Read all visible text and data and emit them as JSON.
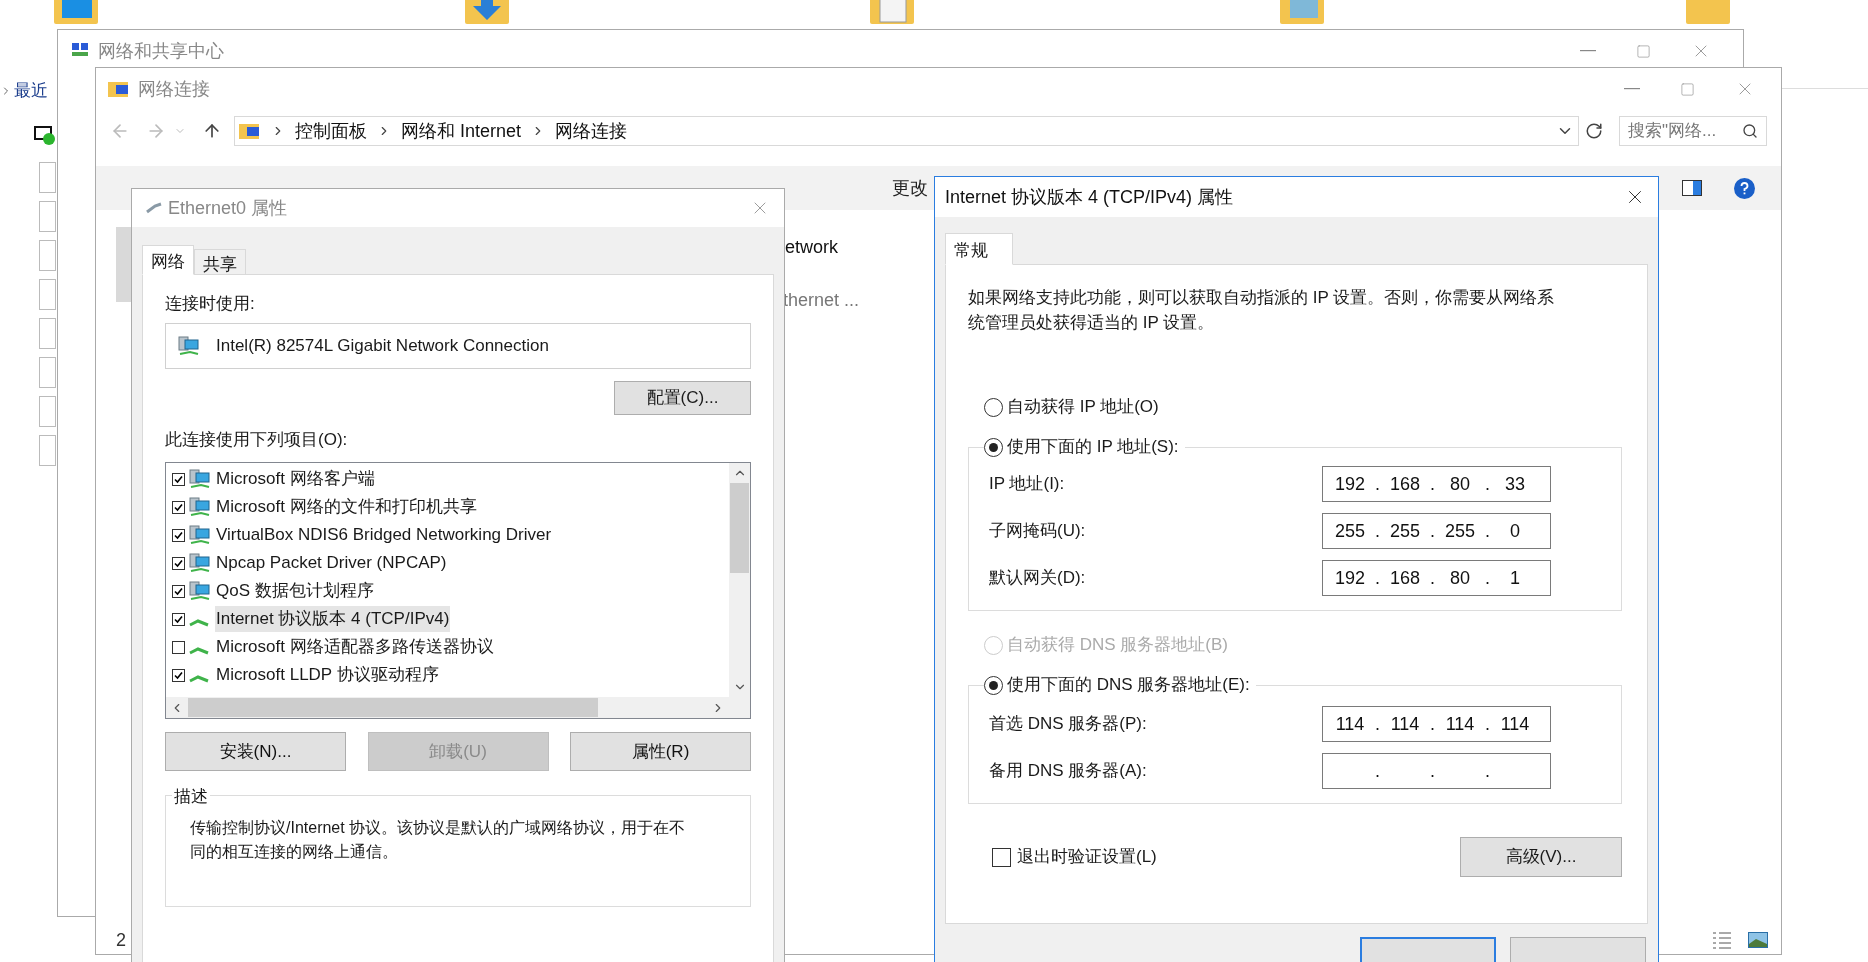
{
  "nav": {
    "label": "最近"
  },
  "sharing_center": {
    "title": "网络和共享中心"
  },
  "connections": {
    "title": "网络连接",
    "breadcrumb": [
      "控制面板",
      "网络和 Internet",
      "网络连接"
    ],
    "search": {
      "placeholder": "搜索\"网络..."
    },
    "toolbar": [
      "更改"
    ],
    "items": [
      {
        "name": "etwork"
      },
      {
        "name": "thernet ..."
      }
    ],
    "status_count": "2"
  },
  "ethernet_dialog": {
    "title": "Ethernet0 属性",
    "tabs": [
      {
        "label": "网络",
        "selected": true
      },
      {
        "label": "共享",
        "selected": false
      }
    ],
    "connect_using_label": "连接时使用:",
    "adapter": "Intel(R) 82574L Gigabit Network Connection",
    "configure_button": "配置(C)...",
    "items_label": "此连接使用下列项目(O):",
    "items": [
      {
        "label": "Microsoft 网络客户端",
        "checked": true,
        "selected": false,
        "kind": "service"
      },
      {
        "label": "Microsoft 网络的文件和打印机共享",
        "checked": true,
        "selected": false,
        "kind": "service"
      },
      {
        "label": "VirtualBox NDIS6 Bridged Networking Driver",
        "checked": true,
        "selected": false,
        "kind": "service"
      },
      {
        "label": "Npcap Packet Driver (NPCAP)",
        "checked": true,
        "selected": false,
        "kind": "service"
      },
      {
        "label": "QoS 数据包计划程序",
        "checked": true,
        "selected": false,
        "kind": "service"
      },
      {
        "label": "Internet 协议版本 4 (TCP/IPv4)",
        "checked": true,
        "selected": true,
        "kind": "protocol"
      },
      {
        "label": "Microsoft 网络适配器多路传送器协议",
        "checked": false,
        "selected": false,
        "kind": "protocol"
      },
      {
        "label": "Microsoft LLDP 协议驱动程序",
        "checked": true,
        "selected": false,
        "kind": "protocol"
      }
    ],
    "buttons": [
      {
        "label": "安装(N)...",
        "disabled": false
      },
      {
        "label": "卸载(U)",
        "disabled": true
      },
      {
        "label": "属性(R)",
        "disabled": false
      }
    ],
    "description_label": "描述",
    "description": "传输控制协议/Internet 协议。该协议是默认的广域网络协议，用于在不同的相互连接的网络上通信。"
  },
  "ipv4_dialog": {
    "title": "Internet 协议版本 4 (TCP/IPv4) 属性",
    "tabs": [
      {
        "label": "常规",
        "selected": true
      }
    ],
    "intro": "如果网络支持此功能，则可以获取自动指派的 IP 设置。否则，你需要从网络系统管理员处获得适当的 IP 设置。",
    "separator": ".",
    "ip_options": [
      {
        "label": "自动获得 IP 地址(O)",
        "selected": false,
        "disabled": false
      },
      {
        "label": "使用下面的 IP 地址(S):",
        "selected": true,
        "disabled": false
      }
    ],
    "ip_fields": [
      {
        "label": "IP 地址(I):",
        "octets": [
          "192",
          "168",
          "80",
          "33"
        ]
      },
      {
        "label": "子网掩码(U):",
        "octets": [
          "255",
          "255",
          "255",
          "0"
        ]
      },
      {
        "label": "默认网关(D):",
        "octets": [
          "192",
          "168",
          "80",
          "1"
        ]
      }
    ],
    "dns_options": [
      {
        "label": "自动获得 DNS 服务器地址(B)",
        "selected": false,
        "disabled": true
      },
      {
        "label": "使用下面的 DNS 服务器地址(E):",
        "selected": true,
        "disabled": false
      }
    ],
    "dns_fields": [
      {
        "label": "首选 DNS 服务器(P):",
        "octets": [
          "114",
          "114",
          "114",
          "114"
        ]
      },
      {
        "label": "备用 DNS 服务器(A):"
      }
    ],
    "validate": {
      "label": "退出时验证设置(L)",
      "checked": false
    },
    "advanced_button": "高级(V)...",
    "buttons": [
      {
        "default": true
      },
      {
        "default": false
      }
    ]
  }
}
